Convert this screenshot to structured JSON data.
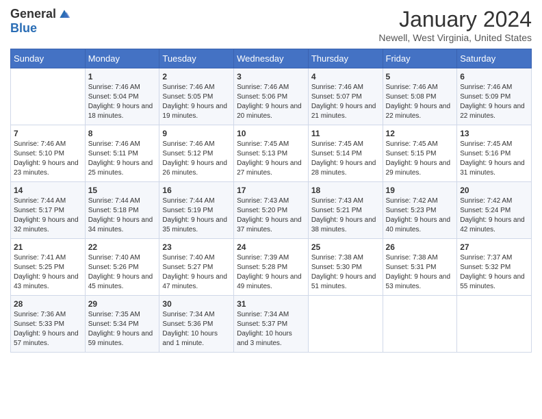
{
  "logo": {
    "general": "General",
    "blue": "Blue"
  },
  "title": "January 2024",
  "location": "Newell, West Virginia, United States",
  "days_header": [
    "Sunday",
    "Monday",
    "Tuesday",
    "Wednesday",
    "Thursday",
    "Friday",
    "Saturday"
  ],
  "weeks": [
    [
      {
        "day": "",
        "sunrise": "",
        "sunset": "",
        "daylight": ""
      },
      {
        "day": "1",
        "sunrise": "Sunrise: 7:46 AM",
        "sunset": "Sunset: 5:04 PM",
        "daylight": "Daylight: 9 hours and 18 minutes."
      },
      {
        "day": "2",
        "sunrise": "Sunrise: 7:46 AM",
        "sunset": "Sunset: 5:05 PM",
        "daylight": "Daylight: 9 hours and 19 minutes."
      },
      {
        "day": "3",
        "sunrise": "Sunrise: 7:46 AM",
        "sunset": "Sunset: 5:06 PM",
        "daylight": "Daylight: 9 hours and 20 minutes."
      },
      {
        "day": "4",
        "sunrise": "Sunrise: 7:46 AM",
        "sunset": "Sunset: 5:07 PM",
        "daylight": "Daylight: 9 hours and 21 minutes."
      },
      {
        "day": "5",
        "sunrise": "Sunrise: 7:46 AM",
        "sunset": "Sunset: 5:08 PM",
        "daylight": "Daylight: 9 hours and 22 minutes."
      },
      {
        "day": "6",
        "sunrise": "Sunrise: 7:46 AM",
        "sunset": "Sunset: 5:09 PM",
        "daylight": "Daylight: 9 hours and 22 minutes."
      }
    ],
    [
      {
        "day": "7",
        "sunrise": "Sunrise: 7:46 AM",
        "sunset": "Sunset: 5:10 PM",
        "daylight": "Daylight: 9 hours and 23 minutes."
      },
      {
        "day": "8",
        "sunrise": "Sunrise: 7:46 AM",
        "sunset": "Sunset: 5:11 PM",
        "daylight": "Daylight: 9 hours and 25 minutes."
      },
      {
        "day": "9",
        "sunrise": "Sunrise: 7:46 AM",
        "sunset": "Sunset: 5:12 PM",
        "daylight": "Daylight: 9 hours and 26 minutes."
      },
      {
        "day": "10",
        "sunrise": "Sunrise: 7:45 AM",
        "sunset": "Sunset: 5:13 PM",
        "daylight": "Daylight: 9 hours and 27 minutes."
      },
      {
        "day": "11",
        "sunrise": "Sunrise: 7:45 AM",
        "sunset": "Sunset: 5:14 PM",
        "daylight": "Daylight: 9 hours and 28 minutes."
      },
      {
        "day": "12",
        "sunrise": "Sunrise: 7:45 AM",
        "sunset": "Sunset: 5:15 PM",
        "daylight": "Daylight: 9 hours and 29 minutes."
      },
      {
        "day": "13",
        "sunrise": "Sunrise: 7:45 AM",
        "sunset": "Sunset: 5:16 PM",
        "daylight": "Daylight: 9 hours and 31 minutes."
      }
    ],
    [
      {
        "day": "14",
        "sunrise": "Sunrise: 7:44 AM",
        "sunset": "Sunset: 5:17 PM",
        "daylight": "Daylight: 9 hours and 32 minutes."
      },
      {
        "day": "15",
        "sunrise": "Sunrise: 7:44 AM",
        "sunset": "Sunset: 5:18 PM",
        "daylight": "Daylight: 9 hours and 34 minutes."
      },
      {
        "day": "16",
        "sunrise": "Sunrise: 7:44 AM",
        "sunset": "Sunset: 5:19 PM",
        "daylight": "Daylight: 9 hours and 35 minutes."
      },
      {
        "day": "17",
        "sunrise": "Sunrise: 7:43 AM",
        "sunset": "Sunset: 5:20 PM",
        "daylight": "Daylight: 9 hours and 37 minutes."
      },
      {
        "day": "18",
        "sunrise": "Sunrise: 7:43 AM",
        "sunset": "Sunset: 5:21 PM",
        "daylight": "Daylight: 9 hours and 38 minutes."
      },
      {
        "day": "19",
        "sunrise": "Sunrise: 7:42 AM",
        "sunset": "Sunset: 5:23 PM",
        "daylight": "Daylight: 9 hours and 40 minutes."
      },
      {
        "day": "20",
        "sunrise": "Sunrise: 7:42 AM",
        "sunset": "Sunset: 5:24 PM",
        "daylight": "Daylight: 9 hours and 42 minutes."
      }
    ],
    [
      {
        "day": "21",
        "sunrise": "Sunrise: 7:41 AM",
        "sunset": "Sunset: 5:25 PM",
        "daylight": "Daylight: 9 hours and 43 minutes."
      },
      {
        "day": "22",
        "sunrise": "Sunrise: 7:40 AM",
        "sunset": "Sunset: 5:26 PM",
        "daylight": "Daylight: 9 hours and 45 minutes."
      },
      {
        "day": "23",
        "sunrise": "Sunrise: 7:40 AM",
        "sunset": "Sunset: 5:27 PM",
        "daylight": "Daylight: 9 hours and 47 minutes."
      },
      {
        "day": "24",
        "sunrise": "Sunrise: 7:39 AM",
        "sunset": "Sunset: 5:28 PM",
        "daylight": "Daylight: 9 hours and 49 minutes."
      },
      {
        "day": "25",
        "sunrise": "Sunrise: 7:38 AM",
        "sunset": "Sunset: 5:30 PM",
        "daylight": "Daylight: 9 hours and 51 minutes."
      },
      {
        "day": "26",
        "sunrise": "Sunrise: 7:38 AM",
        "sunset": "Sunset: 5:31 PM",
        "daylight": "Daylight: 9 hours and 53 minutes."
      },
      {
        "day": "27",
        "sunrise": "Sunrise: 7:37 AM",
        "sunset": "Sunset: 5:32 PM",
        "daylight": "Daylight: 9 hours and 55 minutes."
      }
    ],
    [
      {
        "day": "28",
        "sunrise": "Sunrise: 7:36 AM",
        "sunset": "Sunset: 5:33 PM",
        "daylight": "Daylight: 9 hours and 57 minutes."
      },
      {
        "day": "29",
        "sunrise": "Sunrise: 7:35 AM",
        "sunset": "Sunset: 5:34 PM",
        "daylight": "Daylight: 9 hours and 59 minutes."
      },
      {
        "day": "30",
        "sunrise": "Sunrise: 7:34 AM",
        "sunset": "Sunset: 5:36 PM",
        "daylight": "Daylight: 10 hours and 1 minute."
      },
      {
        "day": "31",
        "sunrise": "Sunrise: 7:34 AM",
        "sunset": "Sunset: 5:37 PM",
        "daylight": "Daylight: 10 hours and 3 minutes."
      },
      {
        "day": "",
        "sunrise": "",
        "sunset": "",
        "daylight": ""
      },
      {
        "day": "",
        "sunrise": "",
        "sunset": "",
        "daylight": ""
      },
      {
        "day": "",
        "sunrise": "",
        "sunset": "",
        "daylight": ""
      }
    ]
  ]
}
